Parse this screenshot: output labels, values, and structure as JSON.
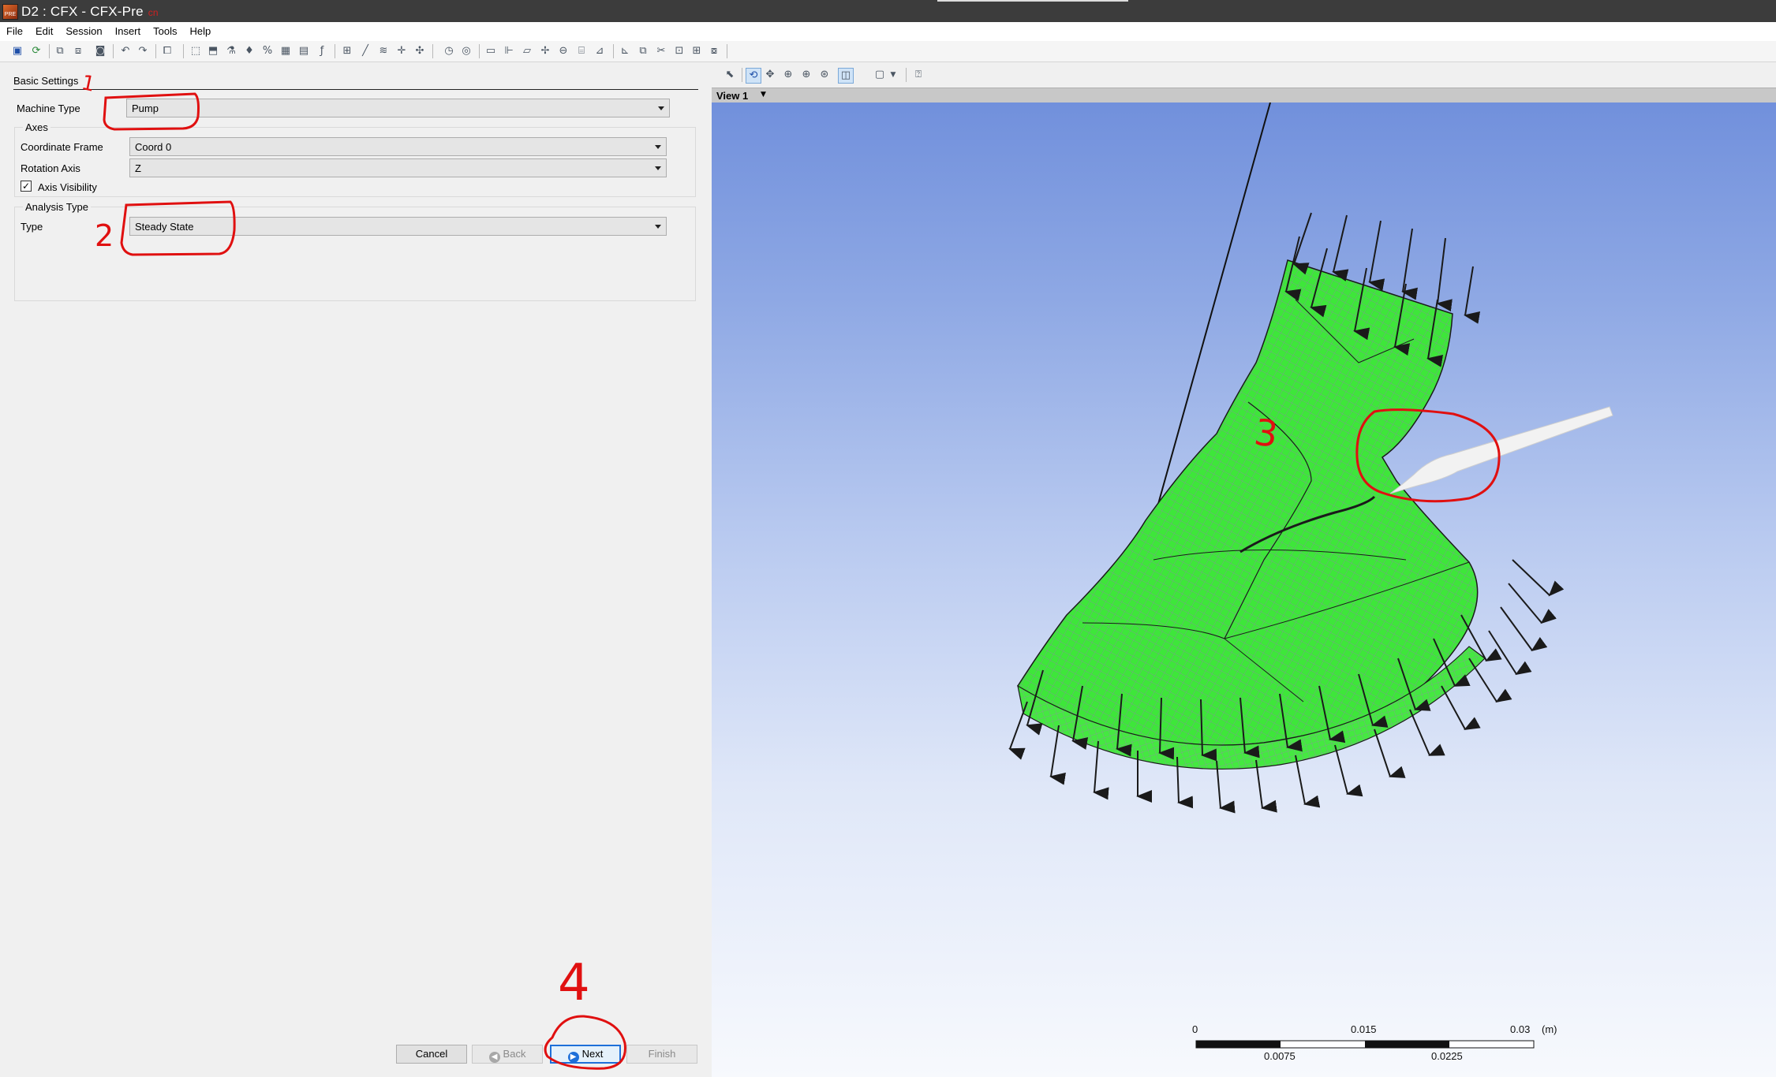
{
  "window": {
    "title": "D2 : CFX - CFX-Pre",
    "title_extra": "cn",
    "icon": "cfx-pre-app-icon"
  },
  "menu": [
    "File",
    "Edit",
    "Session",
    "Insert",
    "Tools",
    "Help"
  ],
  "toolbar": {
    "icons": [
      "save-icon",
      "refresh-icon",
      "import-mesh-icon",
      "export-icon",
      "camera-icon",
      "undo-icon",
      "redo-icon",
      "delete-icon",
      "domain-icon",
      "boundary-icon",
      "subdomain-icon",
      "source-icon",
      "interface-icon",
      "material-icon",
      "reaction-icon",
      "expression-icon",
      "mesh-icon",
      "line-icon",
      "plane-icon",
      "point-icon",
      "clock-icon",
      "solver-icon",
      "output-icon",
      "monitor-icon",
      "transform-icon",
      "graph-icon",
      "table-icon",
      "copy-icon"
    ]
  },
  "panel": {
    "section_title": "Basic Settings",
    "machine_type": {
      "label": "Machine Type",
      "value": "Pump"
    },
    "axes": {
      "title": "Axes",
      "coordinate_frame": {
        "label": "Coordinate Frame",
        "value": "Coord 0"
      },
      "rotation_axis": {
        "label": "Rotation Axis",
        "value": "Z"
      },
      "axis_visibility": {
        "label": "Axis Visibility",
        "checked": true
      }
    },
    "analysis_type": {
      "title": "Analysis Type",
      "type": {
        "label": "Type",
        "value": "Steady State"
      }
    },
    "buttons": {
      "cancel": "Cancel",
      "back": "Back",
      "next": "Next",
      "finish": "Finish"
    }
  },
  "viewer": {
    "view_label": "View 1",
    "toolbar_icons": [
      "select-icon",
      "rotate-icon",
      "pan-icon",
      "zoom-icon",
      "zoom-box-icon",
      "zoom-fit-icon",
      "highlight-icon",
      "viewport-layout-icon",
      "dropdown-icon",
      "help-pointer-icon"
    ],
    "scale": {
      "top_labels": [
        "0",
        "0.015",
        "0.03"
      ],
      "unit": "(m)",
      "bottom_labels": [
        "0.0075",
        "0.0225"
      ]
    }
  },
  "annotations": {
    "step1": "1",
    "step2": "2",
    "step3": "3",
    "step4": "4",
    "color": "#e01010"
  },
  "colors": {
    "mesh_green": "#3ee63a",
    "accent_blue": "#1e6fd9",
    "titlebar": "#3c3c3c"
  }
}
